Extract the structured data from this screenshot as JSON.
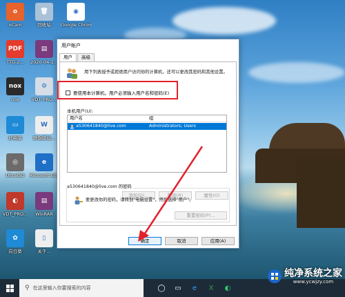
{
  "desktop": {
    "icons": [
      {
        "label": "oCam",
        "color": "#e8622c",
        "glyph": "o"
      },
      {
        "label": "回收站",
        "color": "#a9c2d8",
        "glyph": "🗑"
      },
      {
        "label": "Google Chrome",
        "color": "#ffffff",
        "glyph": "◉"
      },
      {
        "label": "TTG-2...",
        "color": "#e43b2c",
        "glyph": "PDF"
      },
      {
        "label": "2020-04-1...",
        "color": "#7a3a7d",
        "glyph": "▤"
      },
      {
        "label": "nox",
        "color": "#2a2a2a",
        "glyph": "nox"
      },
      {
        "label": "VDT_PRO...",
        "color": "#d6dde6",
        "glyph": "⚙"
      },
      {
        "label": "此电脑",
        "color": "#1f8ad6",
        "glyph": "▭"
      },
      {
        "label": "联想驱动...",
        "color": "#eeeeee",
        "glyph": "W"
      },
      {
        "label": "UltraISO",
        "color": "#6b6b6b",
        "glyph": "◎"
      },
      {
        "label": "Microsoft Edge",
        "color": "#1f6fc7",
        "glyph": "e"
      },
      {
        "label": "VDT_PRO...",
        "color": "#c0392b",
        "glyph": "◐"
      },
      {
        "label": "WinRAR",
        "color": "#7a3a7d",
        "glyph": "▤"
      },
      {
        "label": "向日葵",
        "color": "#1f8ad6",
        "glyph": "✿"
      },
      {
        "label": "关于...",
        "color": "#eeeeee",
        "glyph": "▯"
      }
    ]
  },
  "dialog": {
    "title": "用户帐户",
    "tabs": [
      "用户",
      "高级"
    ],
    "description": "用下列表授予或拒绝用户访问你的计算机，还可以更改其密码和其他设置。",
    "checkbox_label": "要使用本计算机，用户必须输入用户名和密码(E)",
    "checkbox_checked": false,
    "local_users_label": "本机用户(U):",
    "columns": [
      "用户名",
      "组"
    ],
    "rows": [
      {
        "username": "a530641840@live.com",
        "group": "Administrators; Users",
        "selected": true
      }
    ],
    "buttons": {
      "add": "添加(D)...",
      "remove": "删除(R)",
      "properties": "属性(O)"
    },
    "password_group_title": "a530641840@live.com 的密码",
    "password_text": "要更改你的密码，请转到\"电脑设置\"，然后选择\"用户\"。",
    "reset_password": "重置密码(P)...",
    "ok": "确定",
    "cancel": "取消",
    "apply": "应用(A)"
  },
  "taskbar": {
    "search_placeholder": "在这里输入你要搜索的内容"
  },
  "watermark": {
    "title": "纯净系统之家",
    "url": "www.ycwjzy.com"
  },
  "colors": {
    "highlight": "#0078d7",
    "annotation_red": "#e3202a",
    "taskbar": "#1d2b38"
  }
}
